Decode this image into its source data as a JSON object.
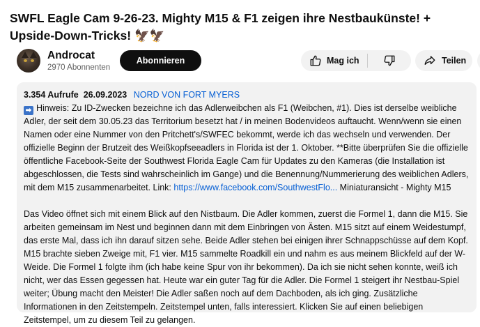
{
  "video": {
    "title": "SWFL Eagle Cam 9-26-23. Mighty M15 & F1 zeigen ihre Nestbaukünste! + Upside-Down-Tricks!",
    "title_emoji": "🦅🦅"
  },
  "channel": {
    "name": "Androcat",
    "subscribers": "2970 Abonnenten",
    "subscribe_label": "Abonnieren"
  },
  "actions": {
    "like_label": "Mag ich",
    "share_label": "Teilen",
    "more_label": "•••",
    "icons": [
      "thumb-up-icon",
      "thumb-down-icon",
      "share-arrow-icon",
      "more-dots-icon"
    ]
  },
  "description": {
    "views": "3.354 Aufrufe",
    "date": "26.09.2023",
    "tag": "NORD VON FORT MYERS",
    "info_icon": "➡",
    "para1_text": "Hinweis: Zu ID-Zwecken bezeichne ich das Adlerweibchen als F1 (Weibchen, #1). Dies ist derselbe weibliche Adler, der seit dem 30.05.23 das Territorium besetzt hat / in meinen Bodenvideos auftaucht. Wenn/wenn sie einen Namen oder eine Nummer von den Pritchett's/SWFEC bekommt, werde ich das wechseln und verwenden. Der offizielle Beginn der Brutzeit des Weißkopfseeadlers in Florida ist der 1. Oktober. **Bitte überprüfen Sie die offizielle öffentliche Facebook-Seite der Southwest Florida Eagle Cam für Updates zu den Kameras (die Installation ist abgeschlossen, die Tests sind wahrscheinlich im Gange) und die Benennung/Nummerierung des weiblichen Adlers, mit dem M15 zusammenarbeitet. Link: ",
    "link_text": "https://www.facebook.com/SouthwestFlo...",
    "para1_after": " Miniaturansicht - Mighty M15",
    "para2_text": "Das Video öffnet sich mit einem Blick auf den Nistbaum. Die Adler kommen, zuerst die Formel 1, dann die M15. Sie arbeiten gemeinsam im Nest und beginnen dann mit dem Einbringen von Ästen. M15 sitzt auf einem Weidestumpf, das erste Mal, dass ich ihn darauf sitzen sehe. Beide Adler stehen bei einigen ihrer Schnappschüsse auf dem Kopf. M15 brachte sieben Zweige mit, F1 vier. M15 sammelte Roadkill ein und nahm es aus meinem Blickfeld auf der W-Weide. Die Formel 1 folgte ihm (ich habe keine Spur von ihr bekommen). Da ich sie nicht sehen konnte, weiß ich nicht, wer das Essen gegessen hat. Heute war ein guter Tag für die Adler. Die Formel 1 steigert ihr Nestbau-Spiel weiter; Übung macht den Meister! Die Adler saßen noch auf dem Dachboden, als ich ging. Zusätzliche Informationen in den Zeitstempeln. Zeitstempel unten, falls interessiert. Klicken Sie auf einen beliebigen Zeitstempel, um zu diesem Teil zu gelangen."
  },
  "colors": {
    "accent_link": "#065fd4",
    "button_dark": "#0f0f0f",
    "pill_bg": "#f2f2f2",
    "desc_bg": "#f2f2f2"
  }
}
